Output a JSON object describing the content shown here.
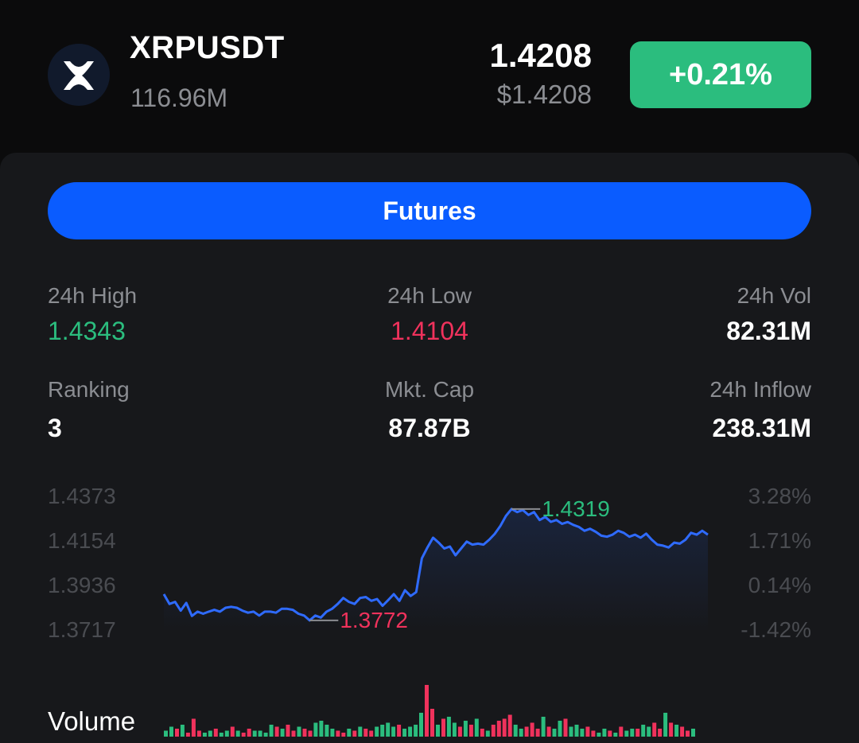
{
  "header": {
    "symbol": "XRPUSDT",
    "turnover": "116.96M",
    "last_price": "1.4208",
    "last_price_usd": "$1.4208",
    "change_pct": "+0.21%",
    "logo_icon": "xrp-logo-icon"
  },
  "actions": {
    "futures_label": "Futures"
  },
  "stats": {
    "high_label": "24h High",
    "high_value": "1.4343",
    "low_label": "24h Low",
    "low_value": "1.4104",
    "vol_label": "24h Vol",
    "vol_value": "82.31M",
    "rank_label": "Ranking",
    "rank_value": "3",
    "mcap_label": "Mkt. Cap",
    "mcap_value": "87.87B",
    "inflow_label": "24h Inflow",
    "inflow_value": "238.31M"
  },
  "colors": {
    "up": "#2bbd7e",
    "down": "#f0325c",
    "line": "#2f6bff",
    "accent": "#0a5cff"
  },
  "chart_data": {
    "type": "line",
    "y_ticks": [
      "1.4373",
      "1.4154",
      "1.3936",
      "1.3717"
    ],
    "y_right_ticks": [
      "3.28%",
      "1.71%",
      "0.14%",
      "-1.42%"
    ],
    "ylim": [
      1.3717,
      1.4373
    ],
    "max_label": "1.4319",
    "min_label": "1.3772",
    "price": [
      1.3901,
      1.3853,
      1.3863,
      1.382,
      1.3858,
      1.3794,
      1.3815,
      1.3805,
      1.3815,
      1.3824,
      1.3815,
      1.3834,
      1.3839,
      1.3834,
      1.382,
      1.381,
      1.3815,
      1.3796,
      1.3815,
      1.3815,
      1.381,
      1.3829,
      1.3829,
      1.3824,
      1.3805,
      1.3796,
      1.3772,
      1.3796,
      1.3786,
      1.3815,
      1.3829,
      1.3853,
      1.3882,
      1.3863,
      1.3853,
      1.3882,
      1.3887,
      1.3868,
      1.3877,
      1.3844,
      1.3872,
      1.3901,
      1.3868,
      1.392,
      1.3892,
      1.3911,
      1.4077,
      1.413,
      1.4178,
      1.4154,
      1.4125,
      1.4135,
      1.4092,
      1.4125,
      1.4159,
      1.4144,
      1.4149,
      1.4144,
      1.4168,
      1.4197,
      1.4236,
      1.4285,
      1.4319,
      1.4304,
      1.4314,
      1.429,
      1.4304,
      1.4265,
      1.428,
      1.4256,
      1.4265,
      1.4246,
      1.4255,
      1.4241,
      1.4231,
      1.4212,
      1.4222,
      1.4207,
      1.4188,
      1.4183,
      1.4193,
      1.4212,
      1.4202,
      1.4183,
      1.4193,
      1.4178,
      1.4198,
      1.4168,
      1.4144,
      1.4139,
      1.413,
      1.4154,
      1.4149,
      1.4168,
      1.4202,
      1.4193,
      1.4212,
      1.4193
    ],
    "volume_label": "Volume",
    "volume": [
      3,
      5,
      4,
      6,
      2,
      9,
      3,
      2,
      3,
      4,
      2,
      3,
      5,
      3,
      2,
      4,
      3,
      3,
      2,
      6,
      5,
      4,
      6,
      3,
      5,
      4,
      3,
      7,
      8,
      6,
      4,
      3,
      2,
      4,
      3,
      5,
      4,
      3,
      5,
      6,
      7,
      5,
      6,
      4,
      5,
      6,
      12,
      26,
      14,
      6,
      9,
      10,
      7,
      5,
      8,
      6,
      9,
      4,
      3,
      6,
      8,
      9,
      11,
      6,
      4,
      5,
      7,
      4,
      10,
      5,
      4,
      8,
      9,
      5,
      6,
      4,
      5,
      3,
      2,
      4,
      3,
      2,
      5,
      3,
      4,
      4,
      6,
      5,
      7,
      4,
      12,
      7,
      6,
      5,
      3,
      4
    ],
    "volume_up": [
      true,
      true,
      false,
      true,
      false,
      false,
      false,
      true,
      true,
      false,
      true,
      true,
      false,
      true,
      false,
      false,
      true,
      true,
      true,
      true,
      false,
      true,
      false,
      false,
      true,
      false,
      false,
      true,
      true,
      true,
      true,
      false,
      false,
      true,
      false,
      true,
      false,
      false,
      true,
      true,
      true,
      true,
      false,
      true,
      true,
      true,
      true,
      false,
      false,
      true,
      false,
      true,
      true,
      false,
      true,
      false,
      true,
      false,
      true,
      false,
      false,
      false,
      false,
      true,
      true,
      false,
      false,
      false,
      true,
      false,
      true,
      true,
      false,
      true,
      true,
      true,
      false,
      false,
      true,
      true,
      false,
      true,
      false,
      true,
      true,
      false,
      true,
      true,
      false,
      false,
      true,
      false,
      true,
      false,
      false,
      true
    ]
  }
}
